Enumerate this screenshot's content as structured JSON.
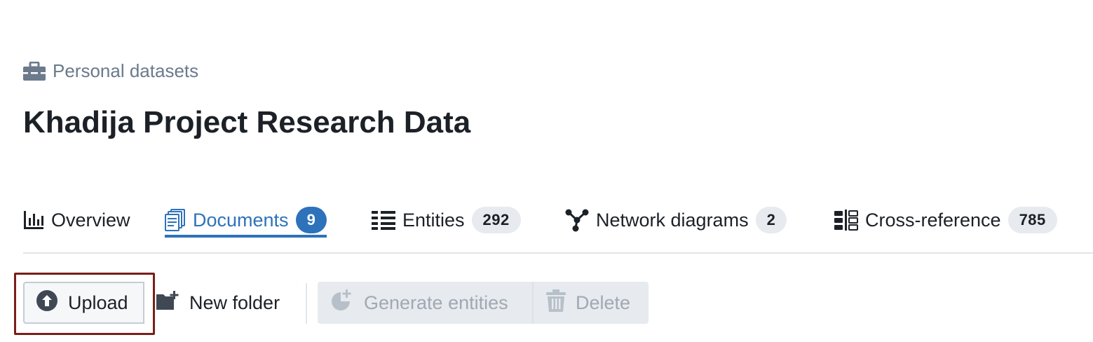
{
  "breadcrumb": {
    "icon": "briefcase-icon",
    "label": "Personal datasets"
  },
  "page": {
    "title": "Khadija Project Research Data"
  },
  "tabs": [
    {
      "id": "overview",
      "icon": "bar-chart-icon",
      "label": "Overview",
      "count": null,
      "active": false
    },
    {
      "id": "documents",
      "icon": "documents-icon",
      "label": "Documents",
      "count": "9",
      "active": true
    },
    {
      "id": "entities",
      "icon": "list-columns-icon",
      "label": "Entities",
      "count": "292",
      "active": false
    },
    {
      "id": "network",
      "icon": "graph-icon",
      "label": "Network diagrams",
      "count": "2",
      "active": false
    },
    {
      "id": "xref",
      "icon": "comparison-icon",
      "label": "Cross-reference",
      "count": "785",
      "active": false
    }
  ],
  "toolbar": {
    "upload_label": "Upload",
    "new_folder_label": "New folder",
    "generate_label": "Generate entities",
    "delete_label": "Delete"
  },
  "colors": {
    "accent": "#2d72ba",
    "muted_text": "#6b7a8c",
    "disabled_text": "#a0a9b3",
    "highlight_border": "#7a1e1a"
  }
}
